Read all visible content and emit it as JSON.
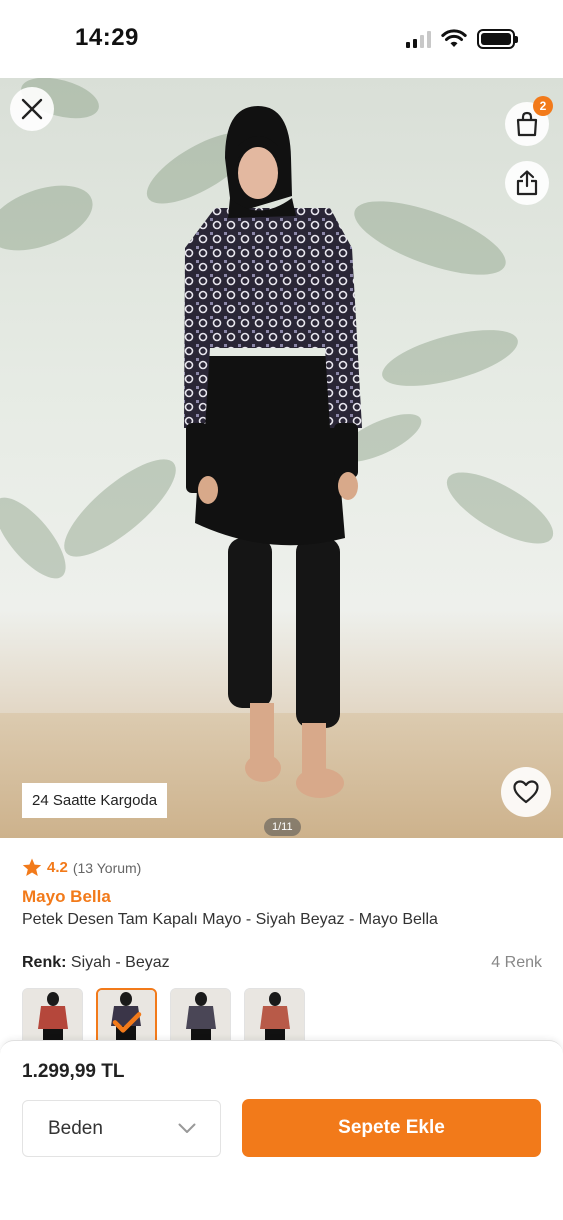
{
  "status_bar": {
    "time": "14:29"
  },
  "product_gallery": {
    "shipping_badge": "24 Saatte Kargoda",
    "image_counter": "1/11",
    "cart_count": "2"
  },
  "product": {
    "rating": "4.2",
    "review_count": "(13 Yorum)",
    "brand": "Mayo Bella",
    "name": "Petek Desen Tam Kapalı Mayo - Siyah Beyaz - Mayo Bella"
  },
  "color_selector": {
    "label": "Renk:",
    "selected_value": "Siyah - Beyaz",
    "count": "4 Renk",
    "selected_index": 1
  },
  "purchase_bar": {
    "price": "1.299,99 TL",
    "size_placeholder": "Beden",
    "add_to_cart_label": "Sepete Ekle"
  },
  "colors": {
    "accent": "#f27a1a",
    "text": "#333333",
    "muted": "#888888"
  },
  "icons": [
    "close-icon",
    "shopping-bag-icon",
    "share-icon",
    "heart-icon",
    "star-icon",
    "chevron-down-icon",
    "checkmark-icon",
    "wifi-icon",
    "signal-icon",
    "battery-icon"
  ]
}
